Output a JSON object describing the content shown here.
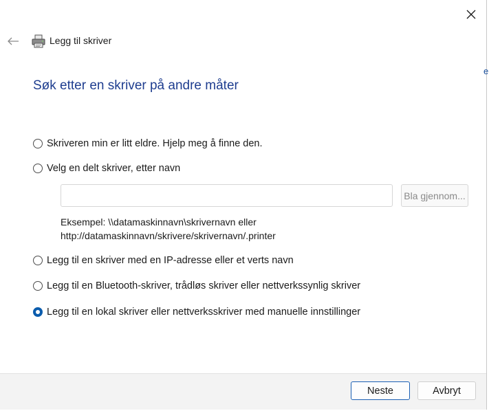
{
  "window": {
    "title": "Legg til skriver",
    "background_peek_text": "e"
  },
  "icons": {
    "close": "close-icon",
    "back": "back-arrow-icon",
    "printer": "printer-icon"
  },
  "main": {
    "heading": "Søk etter en skriver på andre måter",
    "options": [
      {
        "label": "Skriveren min er litt eldre. Hjelp meg å finne den.",
        "selected": false
      },
      {
        "label": "Velg en delt skriver, etter navn",
        "selected": false
      },
      {
        "label": "Legg til en skriver med en IP-adresse eller et verts navn",
        "selected": false
      },
      {
        "label": "Legg til en Bluetooth-skriver, trådløs skriver eller nettverkssynlig skriver",
        "selected": false
      },
      {
        "label": "Legg til en lokal skriver eller nettverksskriver med manuelle innstillinger",
        "selected": true
      }
    ],
    "shared_printer": {
      "input_value": "",
      "browse_label": "Bla gjennom...",
      "example_line1": "Eksempel: \\\\datamaskinnavn\\skrivernavn eller",
      "example_line2": "http://datamaskinnavn/skrivere/skrivernavn/.printer"
    }
  },
  "footer": {
    "next_label": "Neste",
    "cancel_label": "Avbryt"
  },
  "colors": {
    "heading": "#1e3d8f",
    "accent": "#0b5cad",
    "footer_bg": "#f3f3f3"
  }
}
